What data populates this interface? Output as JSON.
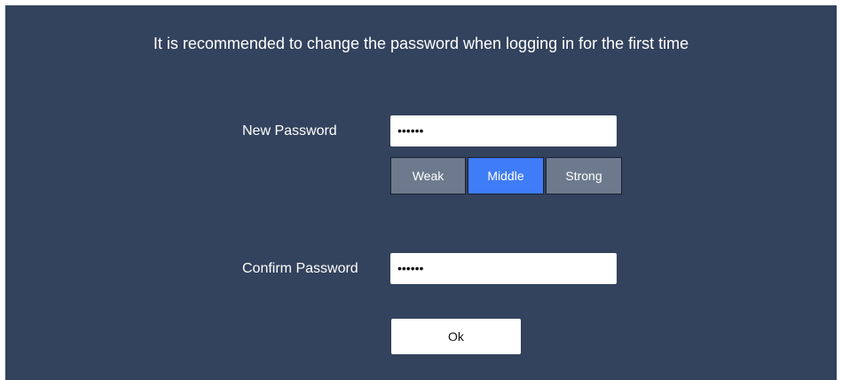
{
  "notice": "It is recommended to change the password when logging in for the first time",
  "new_password": {
    "label": "New Password",
    "value": "••••••"
  },
  "strength": {
    "weak": "Weak",
    "middle": "Middle",
    "strong": "Strong",
    "selected": "Middle"
  },
  "confirm_password": {
    "label": "Confirm Password",
    "value": "••••••"
  },
  "ok_label": "Ok",
  "colors": {
    "panel_bg": "#33425d",
    "strength_inactive": "#6d7a8e",
    "strength_active": "#3f7cf7"
  }
}
